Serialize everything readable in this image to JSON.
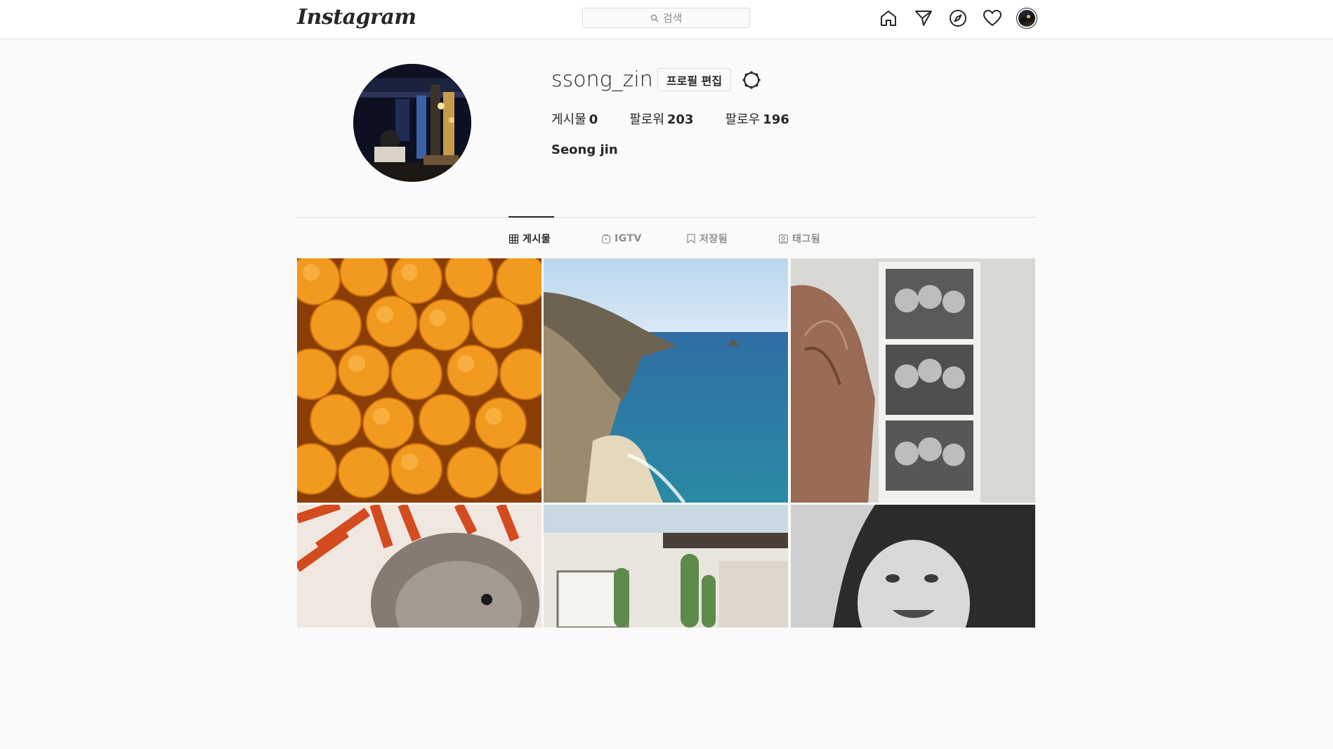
{
  "header": {
    "logo_text": "Instagram",
    "search_placeholder": "검색",
    "icons": [
      "home-icon",
      "direct-icon",
      "explore-icon",
      "activity-icon",
      "profile-avatar"
    ]
  },
  "profile": {
    "username": "ssong_zin",
    "edit_button": "프로필 편집",
    "stats": {
      "posts_label": "게시물",
      "posts_count": "0",
      "followers_label": "팔로워",
      "followers_count": "203",
      "following_label": "팔로우",
      "following_count": "196"
    },
    "full_name": "Seong jin"
  },
  "tabs": [
    {
      "label": "게시물",
      "icon": "grid-icon",
      "active": true
    },
    {
      "label": "IGTV",
      "icon": "igtv-icon",
      "active": false
    },
    {
      "label": "저장됨",
      "icon": "bookmark-icon",
      "active": false
    },
    {
      "label": "태그됨",
      "icon": "tag-icon",
      "active": false
    }
  ],
  "posts": [
    "oranges",
    "coastal-cliff",
    "photo-booth-strip",
    "dog",
    "cactus-building",
    "baby"
  ],
  "colors": {
    "border": "#dbdbdb",
    "background": "#fafafa",
    "text": "#262626",
    "muted": "#8e8e8e"
  }
}
